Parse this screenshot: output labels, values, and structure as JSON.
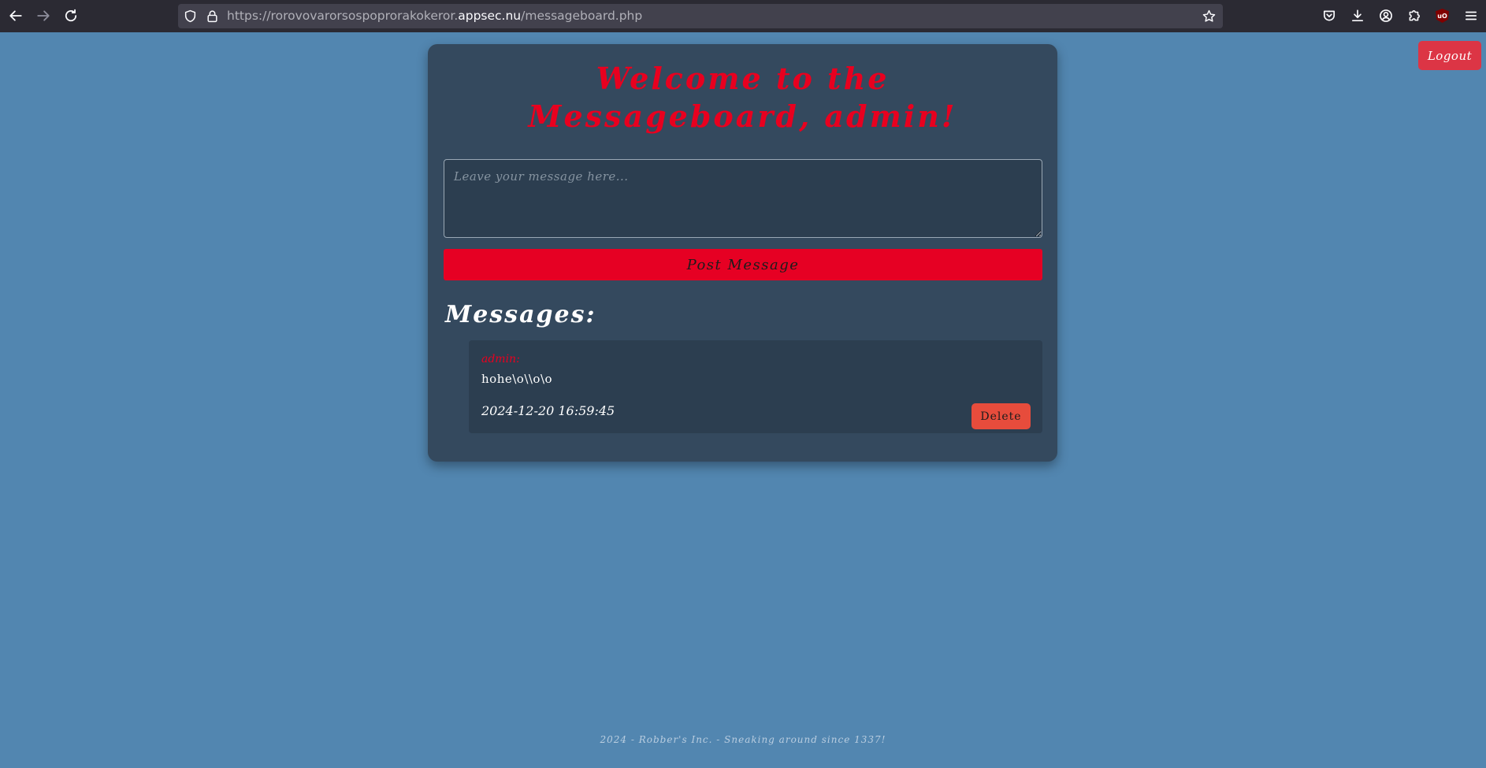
{
  "browser": {
    "url_prefix": "https://rorovovarorsospoprorakokeror.",
    "url_host": "appsec.nu",
    "url_path": "/messageboard.php",
    "icons": {
      "back": "arrow-left-icon",
      "forward": "arrow-right-icon",
      "reload": "reload-icon",
      "shield": "tracking-shield-icon",
      "lock": "lock-icon",
      "bookmark": "star-icon",
      "pocket": "pocket-icon",
      "downloads": "download-icon",
      "account": "account-icon",
      "extensions": "puzzle-icon",
      "ublock": "ublock-icon",
      "menu": "hamburger-menu-icon"
    },
    "ublock_label": "uO"
  },
  "header": {
    "logout_label": "Logout"
  },
  "board": {
    "title": "Welcome to the Messageboard, admin!",
    "input_placeholder": "Leave your message here...",
    "post_label": "Post Message",
    "messages_heading": "Messages:",
    "messages": [
      {
        "author": "admin:",
        "body": "hohe\\o\\\\o\\o",
        "timestamp": "2024-12-20 16:59:45",
        "delete_label": "Delete"
      }
    ]
  },
  "footer": {
    "text": "2024 - Robber's Inc. - Sneaking around since 1337!"
  },
  "colors": {
    "page_bg": "#5286b0",
    "card_bg": "#34495e",
    "accent_red": "#e60023",
    "delete_red": "#e74c3c",
    "logout_red": "#dc3545"
  }
}
